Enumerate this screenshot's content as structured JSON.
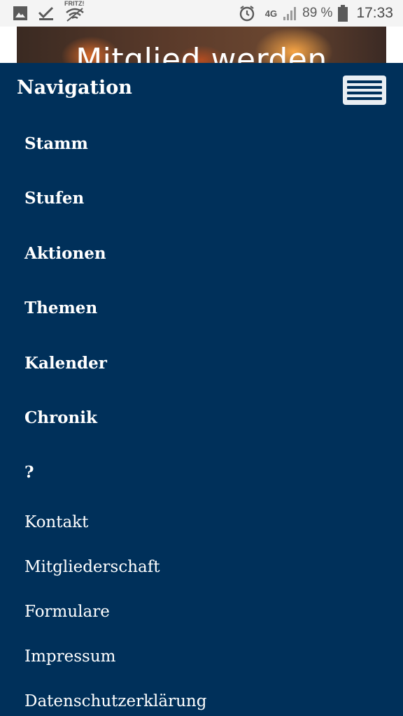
{
  "status_bar": {
    "time": "17:33",
    "battery_pct": "89 %",
    "network_label": "4G",
    "wifi_label": "FRITZ!",
    "icons": [
      "image-icon",
      "checkmark-icon",
      "wifi-icon",
      "alarm-icon",
      "signal-icon",
      "battery-icon"
    ]
  },
  "hero": {
    "title": "Mitglied werden"
  },
  "nav": {
    "heading": "Navigation",
    "primary_items": [
      "Stamm",
      "Stufen",
      "Aktionen",
      "Themen",
      "Kalender",
      "Chronik",
      "?"
    ],
    "secondary_items": [
      "Kontakt",
      "Mitgliederschaft",
      "Formulare",
      "Impressum",
      "Datenschutzerklärung"
    ]
  },
  "colors": {
    "nav_background": "#00305a",
    "nav_text": "#ffffff",
    "status_bar_bg": "#f4f4f4"
  }
}
